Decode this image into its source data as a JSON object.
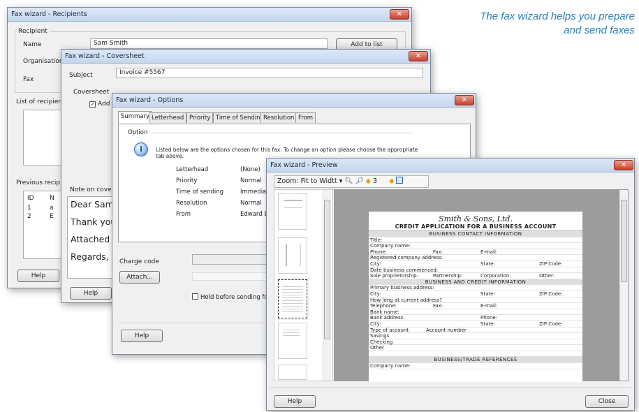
{
  "caption": {
    "line1": "The fax wizard helps you prepare",
    "line2": "and send faxes"
  },
  "recipients": {
    "title": "Fax wizard - Recipients",
    "recipient_label": "Recipient",
    "name_label": "Name",
    "name_value": "Sam Smith",
    "org_label": "Organisation",
    "fax_label": "Fax",
    "add_to_list": "Add to list",
    "list_label": "List of recipient",
    "previous_label": "Previous recip",
    "col_id": "ID",
    "col_name": "N",
    "rows": [
      {
        "id": "1",
        "name": "a"
      },
      {
        "id": "2",
        "name": "E"
      }
    ],
    "help": "Help"
  },
  "coversheet": {
    "title": "Fax wizard - Coversheet",
    "subject_label": "Subject",
    "subject_value": "Invoice #5567",
    "coversheet_label": "Coversheet",
    "add_checkbox": "Add",
    "note_label": "Note on coversh",
    "note_lines": [
      "Dear Sam,",
      "Thank you",
      "Attached is",
      "Regards,"
    ],
    "help": "Help"
  },
  "options": {
    "title": "Fax wizard - Options",
    "tabs": [
      "Summary",
      "Letterhead",
      "Priority",
      "Time of Sending",
      "Resolution",
      "From"
    ],
    "option_label": "Option",
    "info_line1": "Listed below are the options chosen for this fax. To change an option please choose the appropriate",
    "info_line2": "tab above.",
    "rows": [
      {
        "k": "Letterhead",
        "v": "(None)"
      },
      {
        "k": "Priority",
        "v": "Normal"
      },
      {
        "k": "Time of sending",
        "v": "Immediate"
      },
      {
        "k": "Resolution",
        "v": "Normal"
      },
      {
        "k": "From",
        "v": "Edward Br"
      }
    ],
    "charge_label": "Charge code",
    "attach": "Attach...",
    "hold_label": "Hold before sending for fu",
    "help": "Help"
  },
  "preview": {
    "title": "Fax wizard - Preview",
    "zoom_label": "Zoom:",
    "zoom_value": "Fit to Widtt",
    "page_number": "3",
    "help": "Help",
    "close": "Close",
    "doc": {
      "company": "Smith & Sons, Ltd.",
      "heading": "CREDIT APPLICATION FOR A BUSINESS ACCOUNT",
      "rows": [
        {
          "section": "BUSINESS CONTACT INFORMATION"
        },
        {
          "c": [
            "Title:"
          ]
        },
        {
          "c": [
            "Company name:"
          ]
        },
        {
          "c": [
            "Phone:",
            "Fax:",
            "E-mail:"
          ]
        },
        {
          "c": [
            "Registered company address:"
          ]
        },
        {
          "c": [
            "City:",
            "",
            "State:",
            "ZIP Code:"
          ]
        },
        {
          "c": [
            "Date business commenced:"
          ]
        },
        {
          "c": [
            "Sole proprietorship:",
            "Partnership:",
            "Corporation:",
            "Other:"
          ]
        },
        {
          "section": "BUSINESS AND CREDIT INFORMATION"
        },
        {
          "c": [
            "Primary business address:"
          ]
        },
        {
          "c": [
            "City:",
            "",
            "State:",
            "ZIP Code:"
          ]
        },
        {
          "c": [
            "How long at current address?"
          ]
        },
        {
          "c": [
            "Telephone:",
            "Fax:",
            "E-mail:"
          ]
        },
        {
          "c": [
            "Bank name:"
          ]
        },
        {
          "c": [
            "Bank address:",
            "",
            "Phone:"
          ]
        },
        {
          "c": [
            "City:",
            "",
            "State:",
            "ZIP Code:"
          ]
        },
        {
          "c": [
            "Type of account",
            "Account number"
          ]
        },
        {
          "c": [
            "Savings"
          ]
        },
        {
          "c": [
            "Checking"
          ]
        },
        {
          "c": [
            "Other"
          ]
        },
        {
          "gap": true
        },
        {
          "section": "BUSINESS/TRADE REFERENCES"
        },
        {
          "c": [
            "Company name:"
          ]
        }
      ]
    }
  }
}
